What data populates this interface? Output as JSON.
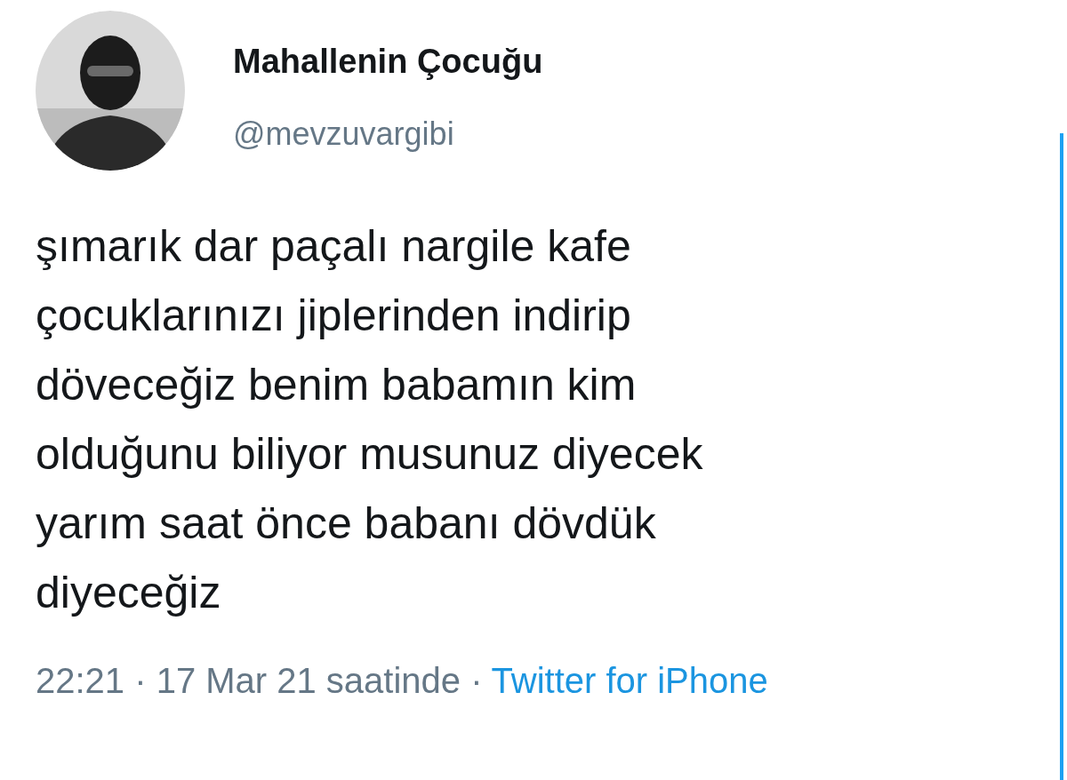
{
  "author": {
    "name": "Mahallenin Çocuğu",
    "handle": "@mevzuvargibi"
  },
  "tweet": {
    "lines": [
      "şımarık dar paçalı nargile kafe",
      "çocuklarınızı jiplerinden indirip",
      "döveceğiz benim babamın kim",
      "olduğunu biliyor musunuz diyecek",
      "yarım saat önce babanı dövdük",
      "diyeceğiz"
    ]
  },
  "footer": {
    "timestamp": "22:21 · 17 Mar 21 saatinde ·",
    "source": "Twitter for iPhone"
  }
}
